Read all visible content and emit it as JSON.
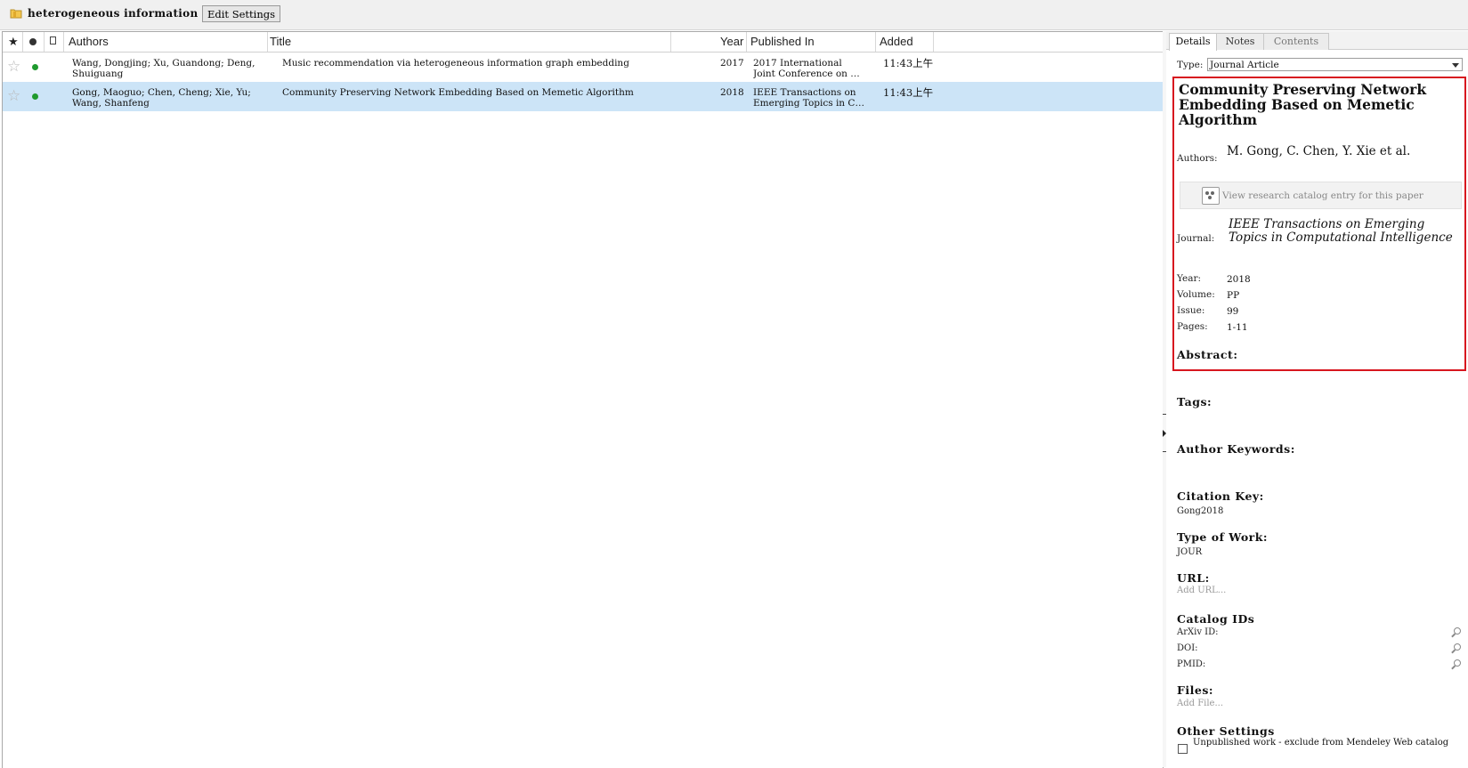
{
  "toolbar": {
    "collection_title": "heterogeneous information",
    "edit_settings_label": "Edit Settings"
  },
  "list": {
    "columns": {
      "favorite_icon": "star-icon",
      "read_icon": "dot-icon",
      "file_icon": "document-icon",
      "authors": "Authors",
      "title": "Title",
      "year": "Year",
      "published_in": "Published In",
      "added": "Added"
    },
    "rows": [
      {
        "favorite": "☆",
        "authors": "Wang, Dongjing; Xu, Guandong; Deng,\nShuiguang",
        "title": "Music recommendation via heterogeneous information graph embedding",
        "year": "2017",
        "published_in": "2017 International\nJoint Conference on …",
        "added": "11:43上午",
        "selected": false
      },
      {
        "favorite": "☆",
        "authors": "Gong, Maoguo; Chen, Cheng; Xie, Yu;\nWang, Shanfeng",
        "title": "Community Preserving Network Embedding Based on Memetic Algorithm",
        "year": "2018",
        "published_in": "IEEE Transactions on\nEmerging Topics in C…",
        "added": "11:43上午",
        "selected": true
      }
    ]
  },
  "details": {
    "tabs": [
      "Details",
      "Notes",
      "Contents"
    ],
    "active_tab": "Details",
    "type_label": "Type:",
    "type_value": "Journal Article",
    "doc_title": "Community Preserving Network Embedding Based on Memetic Algorithm",
    "authors_label": "Authors:",
    "authors_value": "M. Gong, C. Chen, Y. Xie et al.",
    "catalog_button_label": "View research catalog entry for this paper",
    "journal_label": "Journal:",
    "journal_value": "IEEE Transactions on Emerging Topics in Computational Intelligence",
    "year_label": "Year:",
    "year_value": "2018",
    "volume_label": "Volume:",
    "volume_value": "PP",
    "issue_label": "Issue:",
    "issue_value": "99",
    "pages_label": "Pages:",
    "pages_value": "1-11",
    "abstract_heading": "Abstract:",
    "tags_heading": "Tags:",
    "author_keywords_heading": "Author Keywords:",
    "citation_key_heading": "Citation Key:",
    "citation_key_value": "Gong2018",
    "type_of_work_heading": "Type of Work:",
    "type_of_work_value": "JOUR",
    "url_heading": "URL:",
    "url_placeholder": "Add URL...",
    "catalog_ids_heading": "Catalog IDs",
    "arxiv_label": "ArXiv ID:",
    "doi_label": "DOI:",
    "pmid_label": "PMID:",
    "files_heading": "Files:",
    "files_placeholder": "Add File...",
    "other_settings_heading": "Other Settings",
    "unpublished_label": "Unpublished work - exclude from Mendeley Web catalog"
  },
  "colors": {
    "selection": "#cce4f7",
    "highlight_border": "#d7161f",
    "read_dot": "#1f9a2e"
  }
}
